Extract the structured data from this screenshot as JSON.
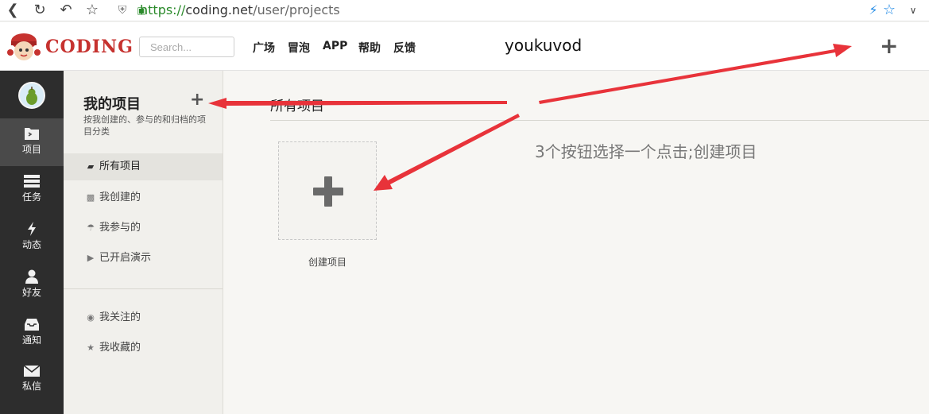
{
  "browser": {
    "url_scheme": "https://",
    "url_host": "coding.net",
    "url_path": "/user/projects"
  },
  "header": {
    "logo_text": "CODING",
    "search_placeholder": "Search...",
    "nav": [
      "广场",
      "冒泡",
      "APP",
      "帮助",
      "反馈"
    ],
    "username": "youkuvod",
    "plus": "+"
  },
  "rail": {
    "items": [
      {
        "label": "项目",
        "icon": "folder-icon"
      },
      {
        "label": "任务",
        "icon": "list-icon"
      },
      {
        "label": "动态",
        "icon": "lightning-icon"
      },
      {
        "label": "好友",
        "icon": "user-icon"
      },
      {
        "label": "通知",
        "icon": "inbox-icon"
      },
      {
        "label": "私信",
        "icon": "envelope-icon"
      }
    ]
  },
  "sidebar": {
    "title": "我的项目",
    "plus": "+",
    "subtitle": "按我创建的、参与的和归档的项目分类",
    "items": [
      {
        "label": "所有项目",
        "icon": "folder-icon"
      },
      {
        "label": "我创建的",
        "icon": "edit-icon"
      },
      {
        "label": "我参与的",
        "icon": "umbrella-icon"
      },
      {
        "label": "已开启演示",
        "icon": "play-icon"
      }
    ],
    "items2": [
      {
        "label": "我关注的",
        "icon": "eye-icon"
      },
      {
        "label": "我收藏的",
        "icon": "star-icon"
      }
    ]
  },
  "main": {
    "title": "所有项目",
    "create_label": "创建项目",
    "annotation": "3个按钮选择一个点击;创建项目"
  },
  "colors": {
    "accent_red": "#e8333a",
    "rail_bg": "#2d2d2d",
    "logo_red": "#c6322f"
  }
}
